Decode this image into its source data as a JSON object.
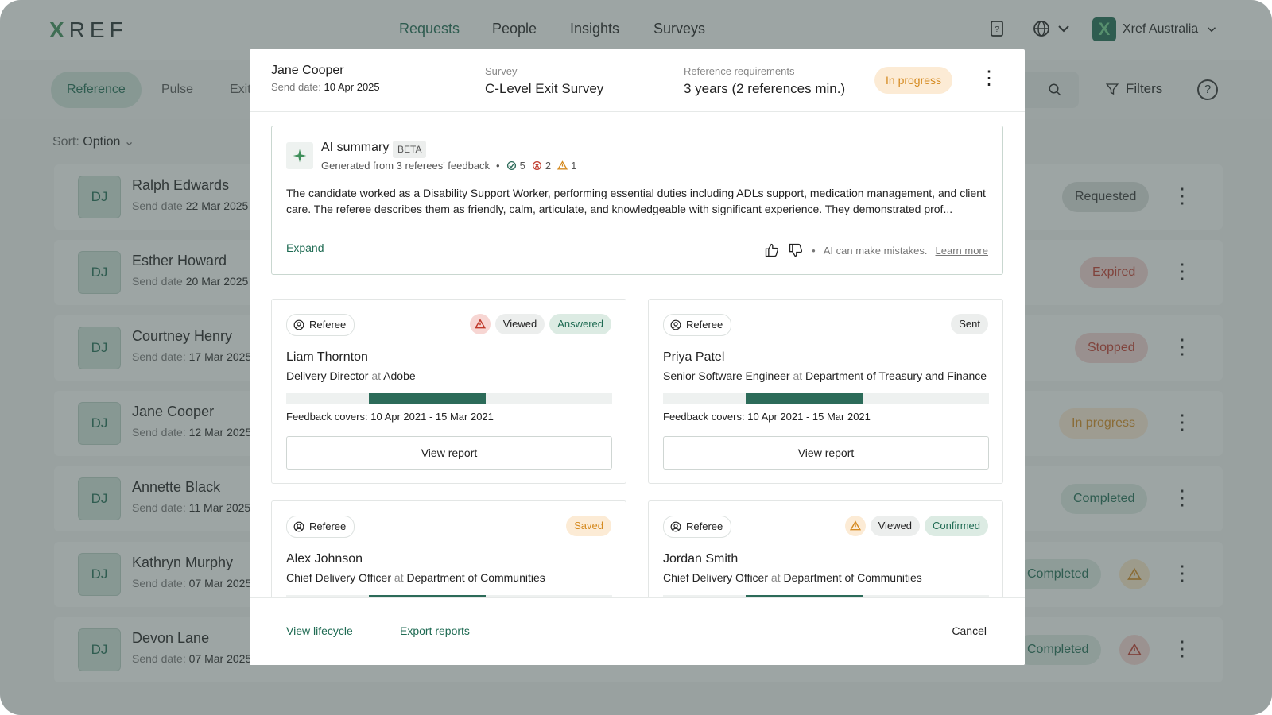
{
  "app": {
    "logo": "XREF",
    "nav": [
      "Requests",
      "People",
      "Insights",
      "Surveys"
    ],
    "account": "Xref Australia",
    "tabs": [
      "Reference",
      "Pulse",
      "Exit"
    ],
    "filters": "Filters",
    "sort_label": "Sort:",
    "sort_value": "Option"
  },
  "rows": [
    {
      "initials": "DJ",
      "name": "Ralph Edwards",
      "date_label": "Send date",
      "date": "22 Mar 2025",
      "status": "Requested",
      "status_color": "#d8dedb",
      "text_color": "#333333"
    },
    {
      "initials": "DJ",
      "name": "Esther Howard",
      "date_label": "Send date",
      "date": "20 Mar 2025",
      "status": "Expired",
      "status_color": "#f3d3d0",
      "text_color": "#c0392b"
    },
    {
      "initials": "DJ",
      "name": "Courtney Henry",
      "date_label": "Send date:",
      "date": "17 Mar 2025",
      "status": "Stopped",
      "status_color": "#f3d3d0",
      "text_color": "#c0392b"
    },
    {
      "initials": "DJ",
      "name": "Jane Cooper",
      "date_label": "Send date:",
      "date": "12 Mar 2025",
      "status": "In progress",
      "status_color": "#fcebd5",
      "text_color": "#d58a20"
    },
    {
      "initials": "DJ",
      "name": "Annette Black",
      "date_label": "Send date:",
      "date": "11 Mar 2025",
      "status": "Completed",
      "status_color": "#dcebe3",
      "text_color": "#1f6b53"
    },
    {
      "initials": "DJ",
      "name": "Kathryn Murphy",
      "date_label": "Send date:",
      "date": "07 Mar 2025",
      "status": "Completed",
      "status_color": "#dcebe3",
      "text_color": "#1f6b53",
      "warn": "amber"
    },
    {
      "initials": "DJ",
      "name": "Devon Lane",
      "date_label": "Send date:",
      "date": "07 Mar 2025",
      "status": "Completed",
      "status_color": "#dcebe3",
      "text_color": "#1f6b53",
      "warn": "red"
    }
  ],
  "modal": {
    "candidate": "Jane Cooper",
    "send_label": "Send date:",
    "send_date": "10 Apr 2025",
    "survey_label": "Survey",
    "survey": "C-Level Exit Survey",
    "req_label": "Reference requirements",
    "req": "3 years (2 references min.)",
    "status": "In progress",
    "ai": {
      "title": "AI summary",
      "beta": "BETA",
      "generated": "Generated from 3 referees' feedback",
      "positive": "5",
      "negative": "2",
      "warning": "1",
      "text": "The candidate worked as a Disability Support Worker, performing essential duties including ADLs support, medication management, and client care. The referee describes them as friendly, calm, articulate, and knowledgeable with significant experience. They demonstrated prof...",
      "expand": "Expand",
      "disclaimer": "AI can make mistakes.",
      "learn_more": "Learn more"
    },
    "cards": [
      {
        "label": "Referee",
        "name": "Liam Thornton",
        "role": "Delivery Director",
        "at": "at",
        "company": "Adobe",
        "covers_label": "Feedback covers:",
        "covers": "10 Apr 2021 - 15 Mar 2021",
        "button": "View report",
        "tags": [
          "Viewed",
          "Answered"
        ]
      },
      {
        "label": "Referee",
        "name": "Priya Patel",
        "role": "Senior Software Engineer",
        "at": "at",
        "company": "Department of Treasury and Finance",
        "covers_label": "Feedback covers:",
        "covers": "10 Apr 2021 - 15 Mar 2021",
        "button": "View report",
        "tags": [
          "Sent"
        ]
      },
      {
        "label": "Referee",
        "name": "Alex Johnson",
        "role": "Chief Delivery Officer",
        "at": "at",
        "company": "Department of Communities",
        "tags": [
          "Saved"
        ]
      },
      {
        "label": "Referee",
        "name": "Jordan Smith",
        "role": "Chief Delivery Officer",
        "at": "at",
        "company": "Department of Communities",
        "tags": [
          "Viewed",
          "Confirmed"
        ]
      }
    ],
    "footer": {
      "lifecycle": "View lifecycle",
      "export": "Export reports",
      "cancel": "Cancel"
    }
  }
}
